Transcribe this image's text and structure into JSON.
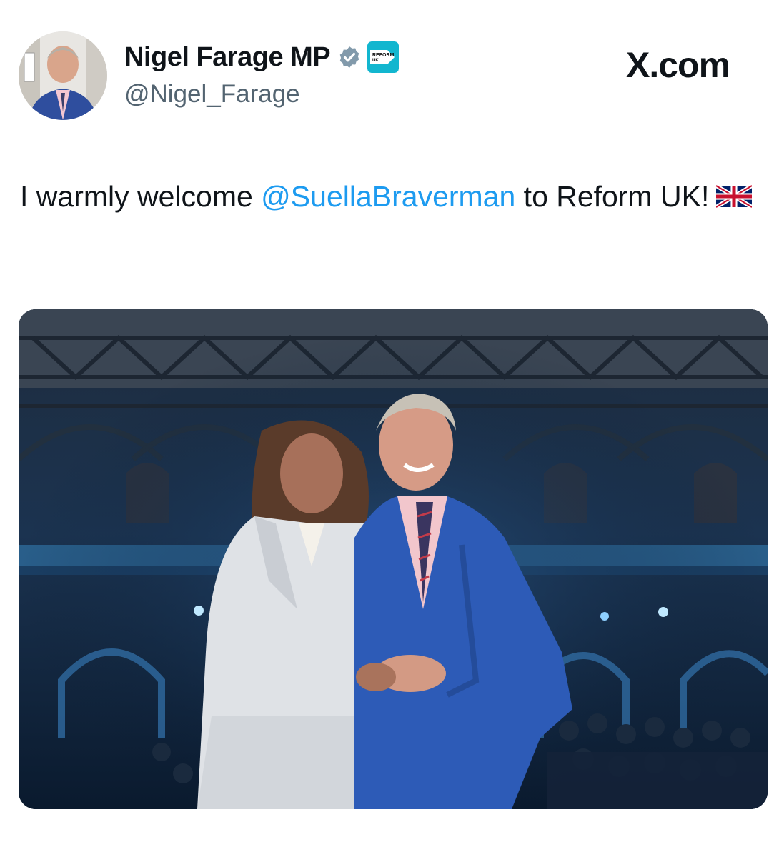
{
  "post": {
    "author": {
      "display_name": "Nigel Farage MP",
      "handle": "@Nigel_Farage",
      "verified": true,
      "verified_icon": "verified-badge-icon",
      "affiliate_badge_text": "REFORM UK"
    },
    "brand": "X.com",
    "text": {
      "part1": "I warmly welcome ",
      "mention": "@SuellaBraverman",
      "part2": " to Reform UK!",
      "emoji": "uk-flag-emoji"
    },
    "media": {
      "type": "photo"
    }
  },
  "colors": {
    "link": "#1d9bf0",
    "text": "#0f1419",
    "secondary": "#536471",
    "verified": "#829aab",
    "reform": "#12b6cf"
  }
}
